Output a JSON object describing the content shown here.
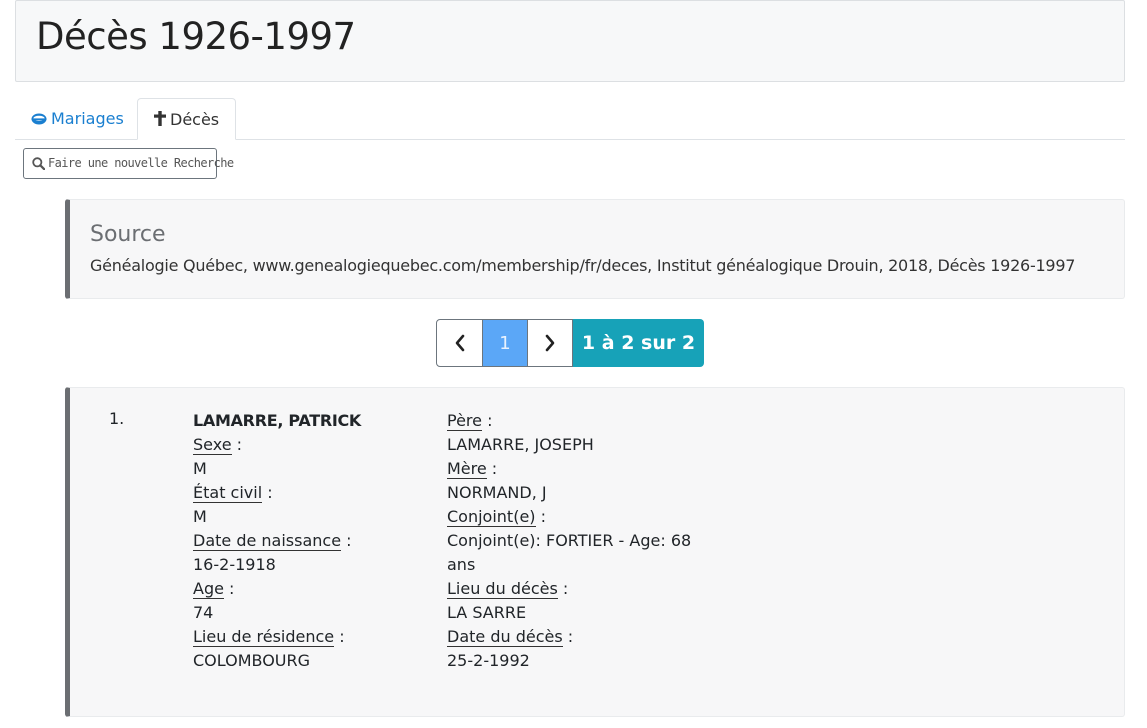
{
  "page": {
    "title": "Décès 1926-1997"
  },
  "tabs": [
    {
      "label": "Mariages",
      "icon": "rings-icon"
    },
    {
      "label": "Décès",
      "icon": "cross-icon"
    }
  ],
  "search": {
    "label": "Faire une nouvelle Recherche",
    "icon": "search-icon"
  },
  "source": {
    "title": "Source",
    "text": "Généalogie Québec, www.genealogiequebec.com/membership/fr/deces, Institut généalogique Drouin, 2018, Décès 1926-1997"
  },
  "pagination": {
    "current_page": "1",
    "summary": "1 à 2 sur 2"
  },
  "record": {
    "index": "1.",
    "name": "LAMARRE, PATRICK",
    "sexe_label": "Sexe",
    "sexe": "M",
    "etat_civil_label": "État civil",
    "etat_civil": "M",
    "naissance_label": "Date de naissance",
    "naissance": "16-2-1918",
    "age_label": "Age",
    "age": "74",
    "residence_label": "Lieu de résidence",
    "residence": "COLOMBOURG",
    "pere_label": "Père",
    "pere": "LAMARRE, JOSEPH",
    "mere_label": "Mère",
    "mere": "NORMAND, J",
    "conjoint_label": "Conjoint(e)",
    "conjoint": "Conjoint(e): FORTIER - Age: 68 ans",
    "lieu_deces_label": "Lieu du décès",
    "lieu_deces": "LA SARRE",
    "date_deces_label": "Date du décès",
    "date_deces": "25-2-1992"
  },
  "colors": {
    "link": "#1a7fd0",
    "pager_active": "#5ba7f7",
    "pager_count": "#17a2b8",
    "source_border": "#6b6e72"
  }
}
